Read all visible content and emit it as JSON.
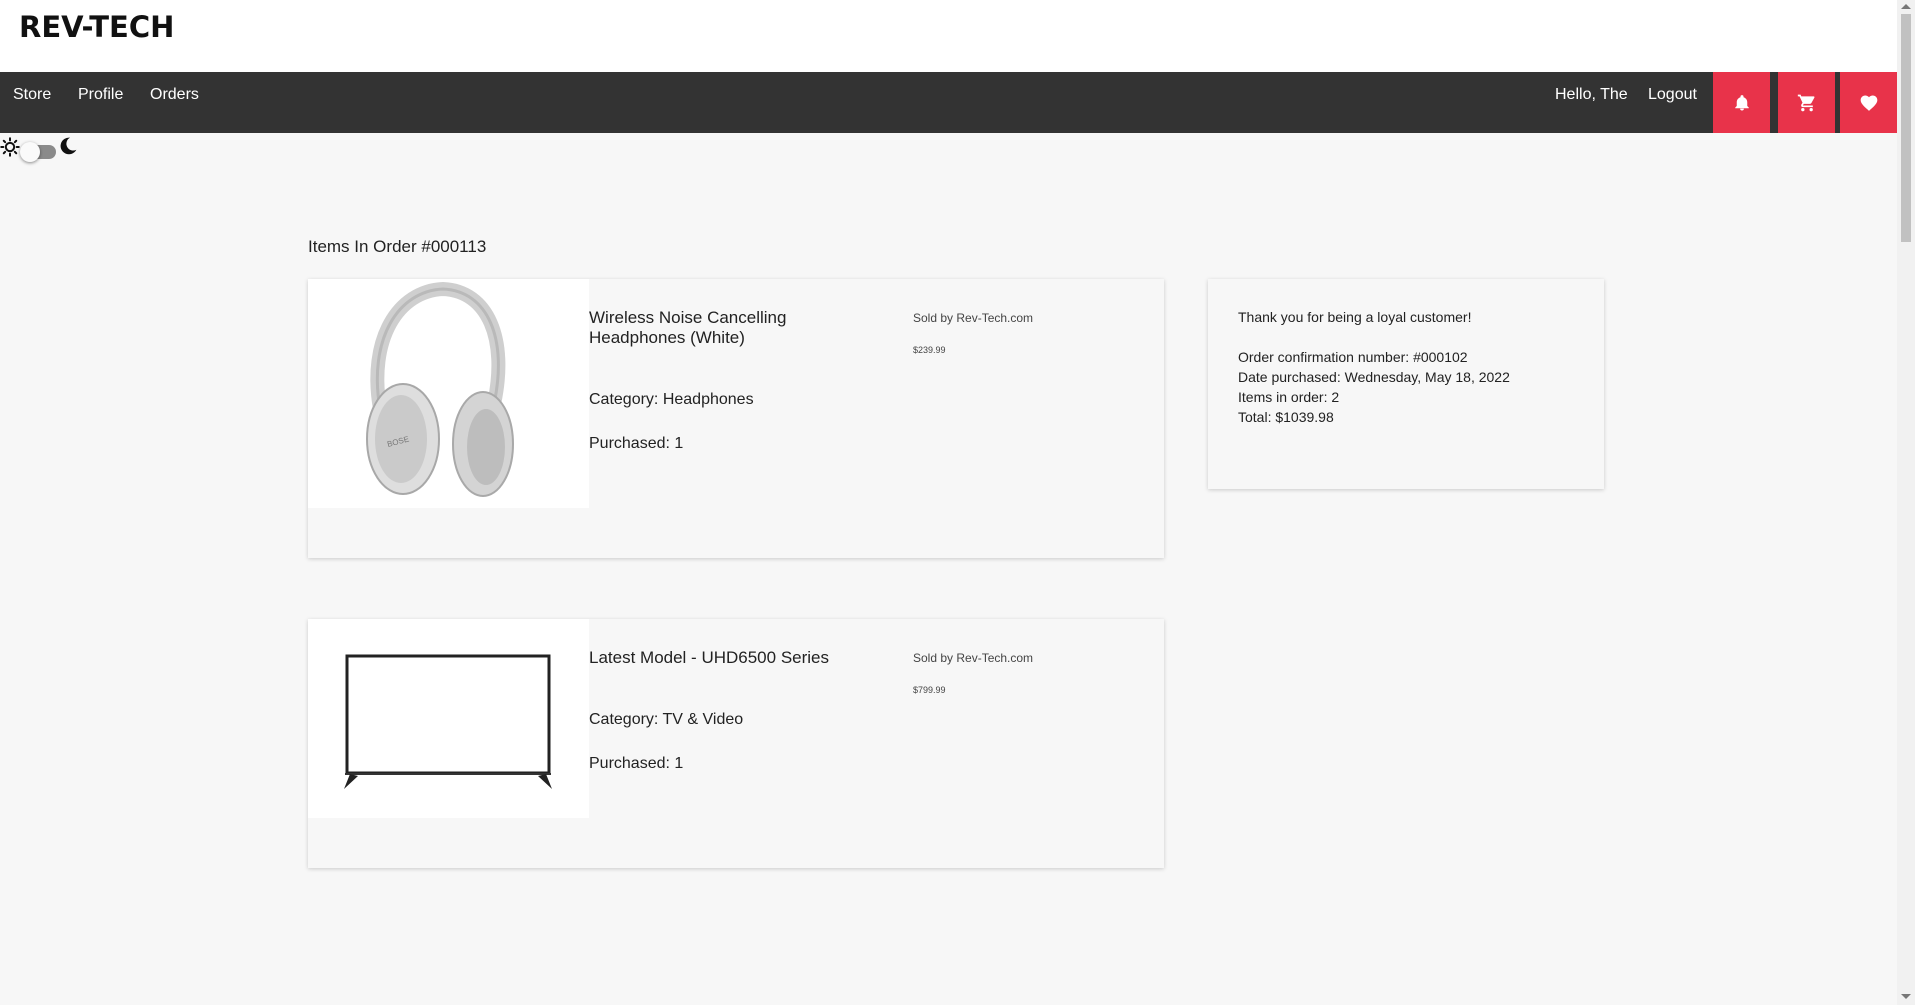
{
  "brand": {
    "name": "REV-TECH"
  },
  "nav": {
    "links": [
      "Store",
      "Profile",
      "Orders"
    ],
    "greeting": "Hello, The",
    "logout": "Logout",
    "icons": [
      "bell-icon",
      "cart-icon",
      "heart-icon"
    ],
    "accent_color": "#e8334a",
    "bar_color": "#333333"
  },
  "theme_toggle": {
    "light_icon": "sun-icon",
    "dark_icon": "moon-icon",
    "mode": "light"
  },
  "order": {
    "heading": "Items In Order #000113",
    "items": [
      {
        "name": "Wireless Noise Cancelling Headphones (White)",
        "category_label": "Category:",
        "category": "Headphones",
        "purchased_label": "Purchased:",
        "purchased": "1",
        "sold_by": "Sold by Rev-Tech.com",
        "price": "$239.99",
        "image": "headphones"
      },
      {
        "name": "Latest Model - UHD6500 Series",
        "category_label": "Category:",
        "category": "TV & Video",
        "purchased_label": "Purchased:",
        "purchased": "1",
        "sold_by": "Sold by Rev-Tech.com",
        "price": "$799.99",
        "image": "television"
      }
    ]
  },
  "summary": {
    "thanks": "Thank you for being a loyal customer!",
    "confirmation": "Order confirmation number: #000102",
    "date": "Date purchased: Wednesday, May 18, 2022",
    "items_count": "Items in order: 2",
    "total": "Total: $1039.98"
  }
}
